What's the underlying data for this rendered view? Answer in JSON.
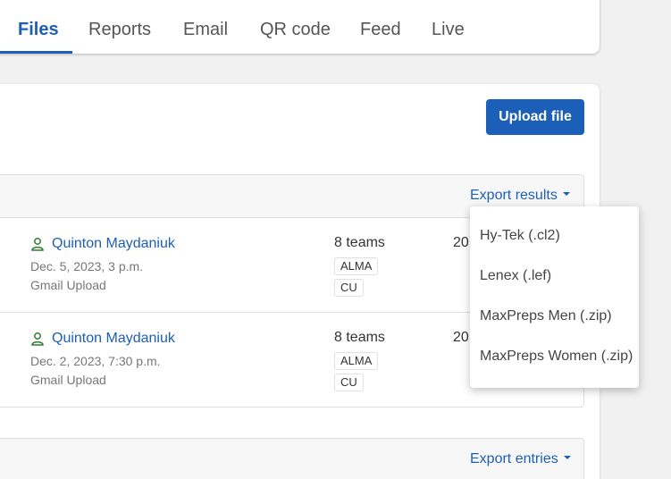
{
  "tabs": [
    {
      "label": "Files",
      "active": true
    },
    {
      "label": "Reports"
    },
    {
      "label": "Email"
    },
    {
      "label": "QR code"
    },
    {
      "label": "Feed"
    },
    {
      "label": "Live"
    }
  ],
  "upload_label": "Upload file",
  "export_results_label": "Export results",
  "export_entries_label": "Export entries",
  "rows": [
    {
      "user": "Quinton Maydaniuk",
      "date": "Dec. 5, 2023, 3 p.m.",
      "source": "Gmail Upload",
      "teams": "8 teams",
      "badges": [
        "ALMA",
        "CU"
      ],
      "year": "20"
    },
    {
      "user": "Quinton Maydaniuk",
      "date": "Dec. 2, 2023, 7:30 p.m.",
      "source": "Gmail Upload",
      "teams": "8 teams",
      "badges": [
        "ALMA",
        "CU"
      ],
      "year": "20"
    }
  ],
  "dropdown": [
    "Hy-Tek (.cl2)",
    "Lenex (.lef)",
    "MaxPreps Men (.zip)",
    "MaxPreps Women (.zip)"
  ],
  "colors": {
    "accent": "#1c5fb8",
    "user_icon": "#2e7d32"
  }
}
